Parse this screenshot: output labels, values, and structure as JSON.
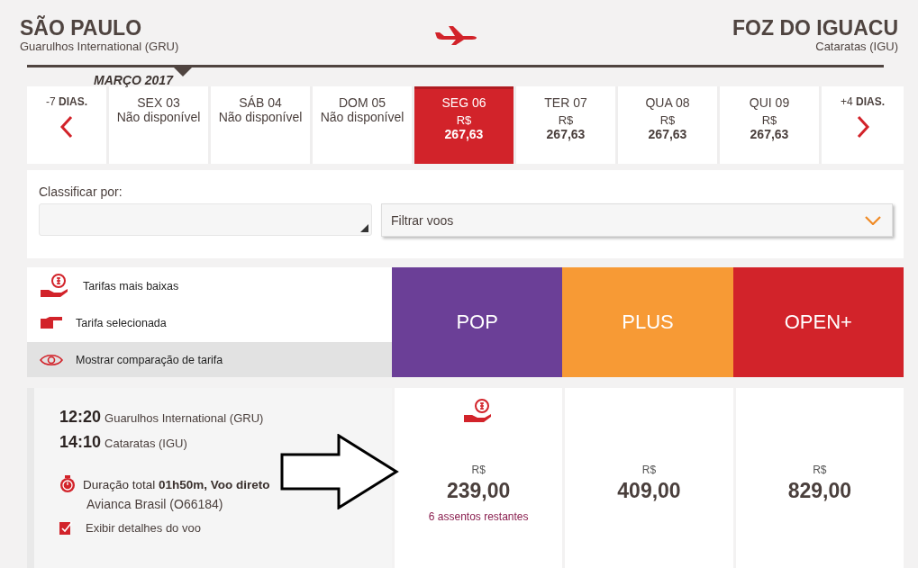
{
  "route": {
    "origin": {
      "city": "SÃO PAULO",
      "airport": "Guarulhos International (GRU)"
    },
    "destination": {
      "city": "FOZ DO IGUACU",
      "airport": "Cataratas (IGU)"
    }
  },
  "month": "MARÇO 2017",
  "dates": [
    {
      "kind": "prev",
      "label": "-7 **DIAS.**"
    },
    {
      "kind": "day",
      "day": "SEX 03",
      "status": "Não disponível",
      "selected": false
    },
    {
      "kind": "day",
      "day": "SÁB 04",
      "status": "Não disponível",
      "selected": false
    },
    {
      "kind": "day",
      "day": "DOM 05",
      "status": "Não disponível",
      "selected": false
    },
    {
      "kind": "day",
      "day": "SEG 06",
      "currency": "R$",
      "price": "267,63",
      "selected": true
    },
    {
      "kind": "day",
      "day": "TER 07",
      "currency": "R$",
      "price": "267,63",
      "selected": false
    },
    {
      "kind": "day",
      "day": "QUA 08",
      "currency": "R$",
      "price": "267,63",
      "selected": false
    },
    {
      "kind": "day",
      "day": "QUI 09",
      "currency": "R$",
      "price": "267,63",
      "selected": false
    },
    {
      "kind": "next",
      "label": "+4 **DIAS.**"
    }
  ],
  "sort": {
    "label": "Classificar por:"
  },
  "filter": {
    "value": "Filtrar voos"
  },
  "legend": [
    {
      "kind": "lowest",
      "text": "Tarifas mais baixas"
    },
    {
      "kind": "selected",
      "text": "Tarifa selecionada"
    },
    {
      "kind": "compare",
      "text": "Mostrar comparação de tarifa"
    }
  ],
  "fare_classes": [
    {
      "name": "POP",
      "color": "#6b3f97"
    },
    {
      "name": "PLUS",
      "color": "#f79a35"
    },
    {
      "name": "OPEN+",
      "color": "#d2232a"
    }
  ],
  "flight": {
    "departure": {
      "time": "12:20",
      "airport": "Guarulhos International (GRU)"
    },
    "arrival": {
      "time": "14:10",
      "airport": "Cataratas (IGU)"
    },
    "duration": "Duração total **01h50m, Voo direto**",
    "carrier": "Avianca Brasil (O66184)",
    "details_link": "Exibir detalhes do voo",
    "fares": [
      {
        "currency": "R$",
        "price": "239,00",
        "lowest": true,
        "seats": "6 assentos restantes"
      },
      {
        "currency": "R$",
        "price": "409,00",
        "lowest": false
      },
      {
        "currency": "R$",
        "price": "829,00",
        "lowest": false
      }
    ]
  }
}
